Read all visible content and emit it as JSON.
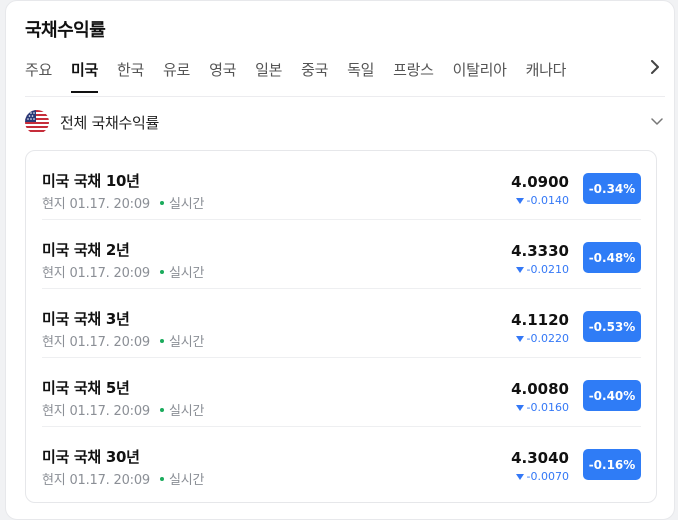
{
  "header": {
    "title": "국채수익률"
  },
  "tabs": [
    {
      "label": "주요"
    },
    {
      "label": "미국",
      "active": true
    },
    {
      "label": "한국"
    },
    {
      "label": "유로"
    },
    {
      "label": "영국"
    },
    {
      "label": "일본"
    },
    {
      "label": "중국"
    },
    {
      "label": "독일"
    },
    {
      "label": "프랑스"
    },
    {
      "label": "이탈리아"
    },
    {
      "label": "캐나다"
    }
  ],
  "tabs_next_icon": "chevron-right-icon",
  "country_selector": {
    "flag_icon": "us-flag-icon",
    "label": "전체 국채수익률",
    "chevron_icon": "chevron-down-icon"
  },
  "colors": {
    "accent": "#2f7cf6",
    "down": "#3478f6",
    "live": "#1aab5c"
  },
  "bonds": [
    {
      "name": "미국 국채 10년",
      "time": "현지 01.17. 20:09",
      "status": "실시간",
      "yield": "4.0900",
      "change": "-0.0140",
      "percent": "-0.34%"
    },
    {
      "name": "미국 국채 2년",
      "time": "현지 01.17. 20:09",
      "status": "실시간",
      "yield": "4.3330",
      "change": "-0.0210",
      "percent": "-0.48%"
    },
    {
      "name": "미국 국채 3년",
      "time": "현지 01.17. 20:09",
      "status": "실시간",
      "yield": "4.1120",
      "change": "-0.0220",
      "percent": "-0.53%"
    },
    {
      "name": "미국 국채 5년",
      "time": "현지 01.17. 20:09",
      "status": "실시간",
      "yield": "4.0080",
      "change": "-0.0160",
      "percent": "-0.40%"
    },
    {
      "name": "미국 국채 30년",
      "time": "현지 01.17. 20:09",
      "status": "실시간",
      "yield": "4.3040",
      "change": "-0.0070",
      "percent": "-0.16%"
    }
  ]
}
